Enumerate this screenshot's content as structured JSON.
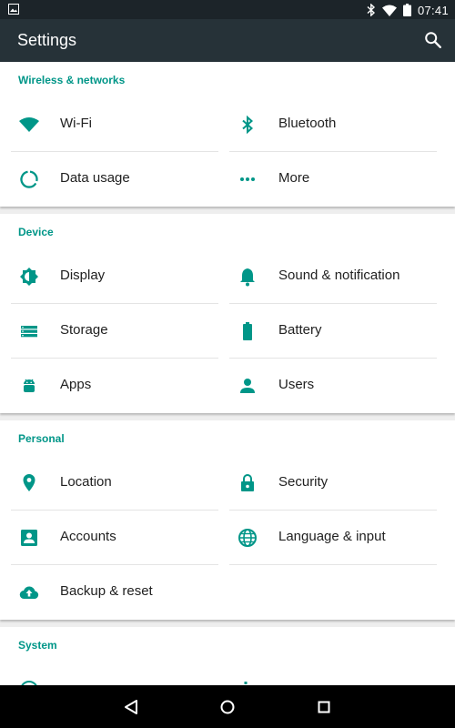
{
  "status_bar": {
    "time": "07:41",
    "icons": [
      "image-icon",
      "bluetooth-icon",
      "wifi-icon",
      "battery-icon"
    ]
  },
  "toolbar": {
    "title": "Settings",
    "search_icon": "search-icon"
  },
  "accent_color": "#009688",
  "toolbar_color": "#263238",
  "sections": [
    {
      "header": "Wireless & networks",
      "items": [
        {
          "label": "Wi-Fi",
          "icon": "wifi-icon"
        },
        {
          "label": "Bluetooth",
          "icon": "bluetooth-icon"
        },
        {
          "label": "Data usage",
          "icon": "data-usage-icon"
        },
        {
          "label": "More",
          "icon": "more-icon"
        }
      ]
    },
    {
      "header": "Device",
      "items": [
        {
          "label": "Display",
          "icon": "brightness-icon"
        },
        {
          "label": "Sound & notification",
          "icon": "bell-icon"
        },
        {
          "label": "Storage",
          "icon": "storage-icon"
        },
        {
          "label": "Battery",
          "icon": "battery-icon"
        },
        {
          "label": "Apps",
          "icon": "android-icon"
        },
        {
          "label": "Users",
          "icon": "person-icon"
        }
      ]
    },
    {
      "header": "Personal",
      "items": [
        {
          "label": "Location",
          "icon": "location-pin-icon"
        },
        {
          "label": "Security",
          "icon": "lock-icon"
        },
        {
          "label": "Accounts",
          "icon": "account-box-icon"
        },
        {
          "label": "Language & input",
          "icon": "globe-icon"
        },
        {
          "label": "Backup & reset",
          "icon": "cloud-upload-icon"
        }
      ]
    },
    {
      "header": "System",
      "items": []
    }
  ],
  "navbar": {
    "icons": [
      "back-icon",
      "home-icon",
      "recents-icon"
    ]
  }
}
